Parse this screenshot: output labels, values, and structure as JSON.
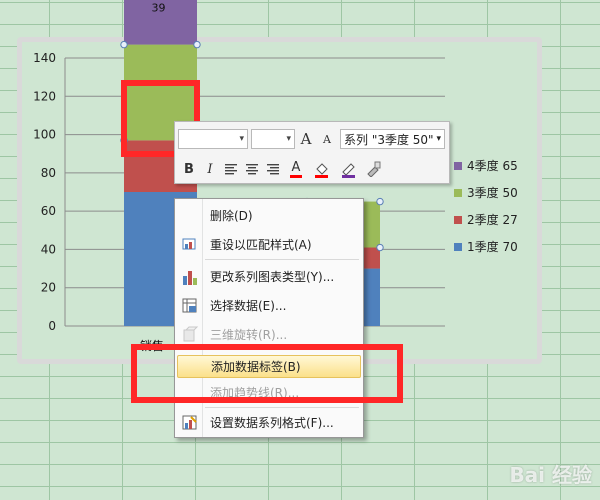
{
  "chart_data": {
    "type": "bar",
    "stacked": true,
    "categories": [
      "销售",
      ""
    ],
    "series": [
      {
        "name": "1季度",
        "values": [
          70,
          30
        ],
        "color": "#4f81bd"
      },
      {
        "name": "2季度",
        "values": [
          27,
          11
        ],
        "color": "#c0504d"
      },
      {
        "name": "3季度",
        "values": [
          50,
          24
        ],
        "color": "#9bbb59"
      },
      {
        "name": "4季度",
        "values": [
          39,
          0
        ],
        "color": "#8064a2"
      }
    ],
    "yticks": [
      0,
      20,
      40,
      60,
      80,
      100,
      120,
      140
    ],
    "ylim": [
      0,
      140
    ],
    "grid": true,
    "legend_position": "right",
    "data_labels": [
      {
        "series": "4季度",
        "category": "销售",
        "text": "39"
      }
    ]
  },
  "legend": [
    {
      "label": "4季度 65",
      "color": "#8064a2"
    },
    {
      "label": "3季度 50",
      "color": "#9bbb59"
    },
    {
      "label": "2季度 27",
      "color": "#c0504d"
    },
    {
      "label": "1季度 70",
      "color": "#4f81bd"
    }
  ],
  "category_label_partial": "销售",
  "mini_toolbar": {
    "series_selector": "系列 \"3季度 50\"",
    "bold": "B",
    "italic": "I",
    "grow_font": "A",
    "shrink_font": "A",
    "font_color": "A"
  },
  "context_menu": {
    "items": [
      {
        "label": "删除(D)",
        "icon": "none",
        "disabled": false
      },
      {
        "label": "重设以匹配样式(A)",
        "icon": "reset-style-icon",
        "disabled": false
      },
      {
        "label": "更改系列图表类型(Y)...",
        "icon": "bar-chart-icon",
        "disabled": false
      },
      {
        "label": "选择数据(E)...",
        "icon": "select-data-icon",
        "disabled": false
      },
      {
        "label": "三维旋转(R)...",
        "icon": "rotate-3d-icon",
        "disabled": true
      },
      {
        "label": "添加数据标签(B)",
        "icon": "none",
        "disabled": false,
        "highlighted": true
      },
      {
        "label": "添加趋势线(R)...",
        "icon": "none",
        "disabled": true
      },
      {
        "label": "设置数据系列格式(F)...",
        "icon": "format-series-icon",
        "disabled": false
      }
    ]
  },
  "watermark": "Bai 经验",
  "colors": {
    "annotation_red": "#ff2727",
    "sheet_background": "#cfe6d2",
    "gridline": "#9ec6a4"
  }
}
